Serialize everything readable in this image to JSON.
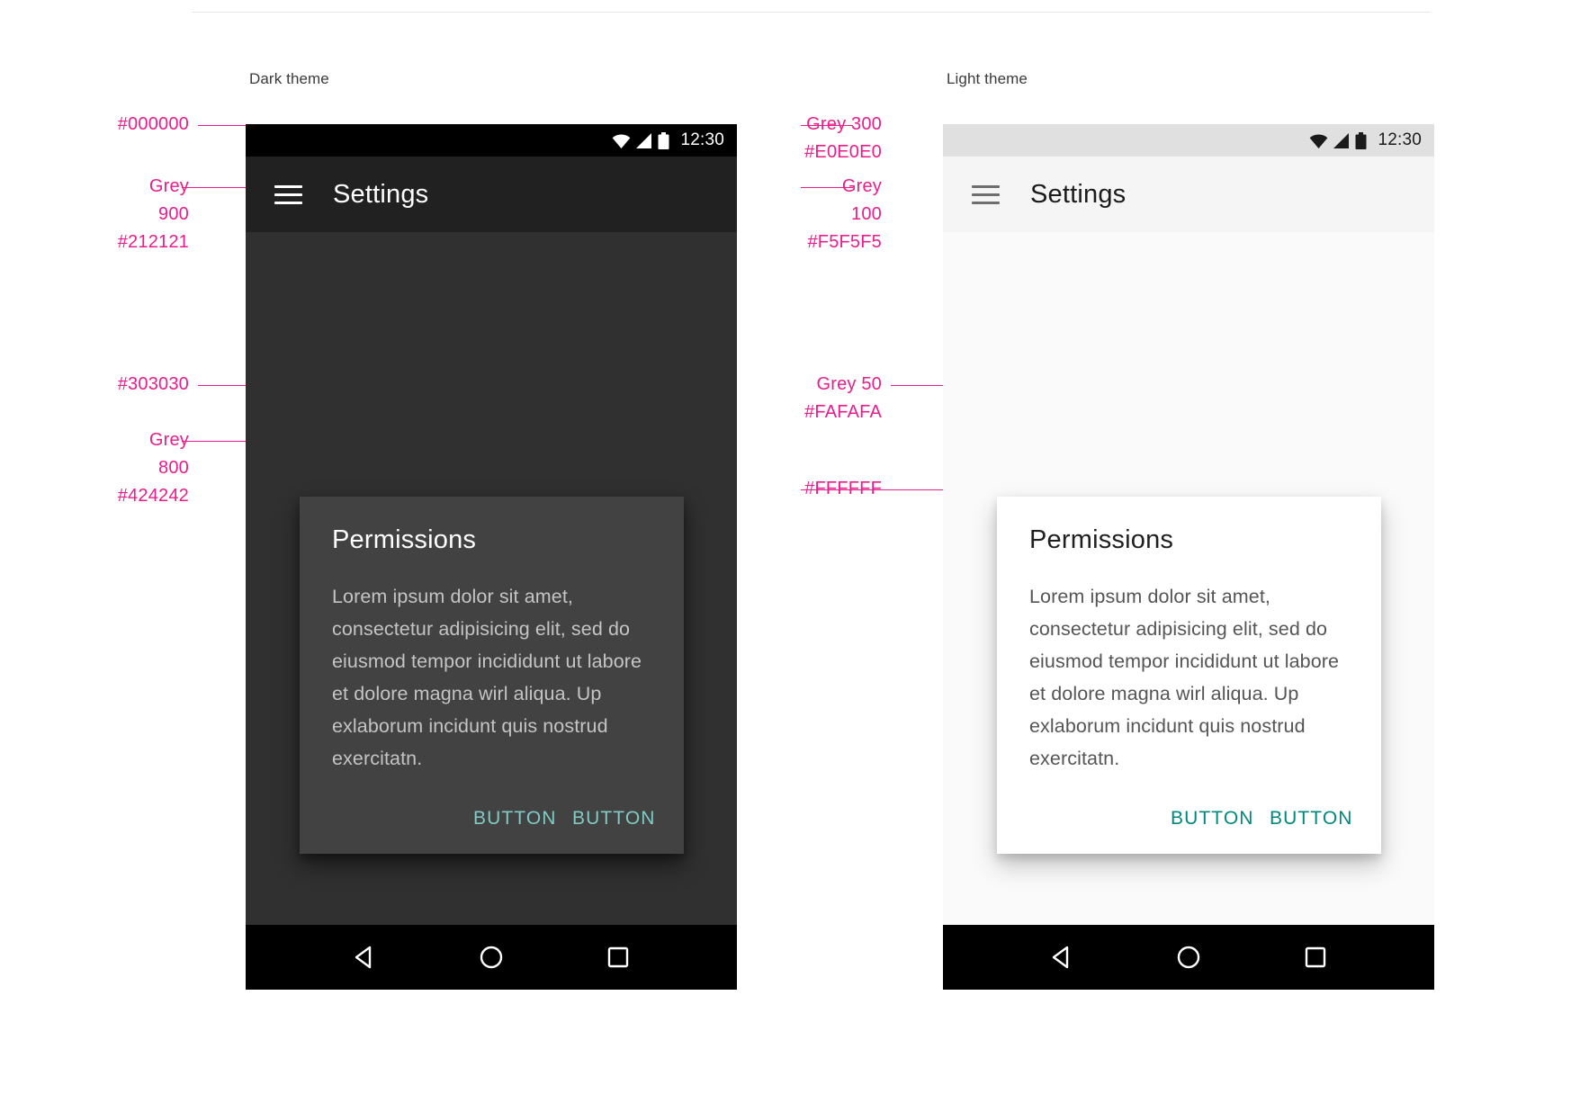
{
  "captions": {
    "dark": "Dark theme",
    "light": "Light theme"
  },
  "annotations": {
    "dark": [
      {
        "name": "status-bar-color",
        "text": "#000000"
      },
      {
        "name": "app-bar-color",
        "text": "Grey\n900\n#212121"
      },
      {
        "name": "background-color",
        "text": "#303030"
      },
      {
        "name": "dialog-surface-color",
        "text": "Grey\n800\n#424242"
      }
    ],
    "light": [
      {
        "name": "status-bar-color",
        "text": "Grey 300\n#E0E0E0"
      },
      {
        "name": "app-bar-color",
        "text": "Grey\n100\n#F5F5F5"
      },
      {
        "name": "background-color",
        "text": "Grey 50\n#FAFAFA"
      },
      {
        "name": "dialog-surface-color",
        "text": "#FFFFFF"
      }
    ]
  },
  "dark_phone": {
    "status": {
      "time": "12:30",
      "icons": [
        "wifi-icon",
        "signal-icon",
        "battery-icon"
      ]
    },
    "appbar": {
      "menu_icon": "hamburger-menu-icon",
      "title": "Settings"
    },
    "dialog": {
      "title": "Permissions",
      "body": "Lorem ipsum dolor sit amet, consectetur adipisicing elit, sed do eiusmod tempor incididunt ut labore et dolore magna wirl aliqua. Up exlaborum incidunt quis nostrud exercitatn.",
      "button_1": "BUTTON",
      "button_2": "BUTTON"
    },
    "navbar": {
      "back": "back-triangle-icon",
      "home": "home-circle-icon",
      "recents": "recents-square-icon"
    }
  },
  "light_phone": {
    "status": {
      "time": "12:30",
      "icons": [
        "wifi-icon",
        "signal-icon",
        "battery-icon"
      ]
    },
    "appbar": {
      "menu_icon": "hamburger-menu-icon",
      "title": "Settings"
    },
    "dialog": {
      "title": "Permissions",
      "body": "Lorem ipsum dolor sit amet, consectetur adipisicing elit, sed do eiusmod tempor incididunt ut labore et dolore magna wirl aliqua. Up exlaborum incidunt quis nostrud exercitatn.",
      "button_1": "BUTTON",
      "button_2": "BUTTON"
    },
    "navbar": {
      "back": "back-triangle-icon",
      "home": "home-circle-icon",
      "recents": "recents-square-icon"
    }
  },
  "colors": {
    "annotation_pink": "#E91E8C",
    "dark_statusbar": "#000000",
    "dark_appbar": "#212121",
    "dark_background": "#303030",
    "dark_dialog": "#424242",
    "light_statusbar": "#E0E0E0",
    "light_appbar": "#F5F5F5",
    "light_background": "#FAFAFA",
    "light_dialog": "#FFFFFF",
    "dark_accent": "#80CBC4",
    "light_accent": "#00897B"
  }
}
